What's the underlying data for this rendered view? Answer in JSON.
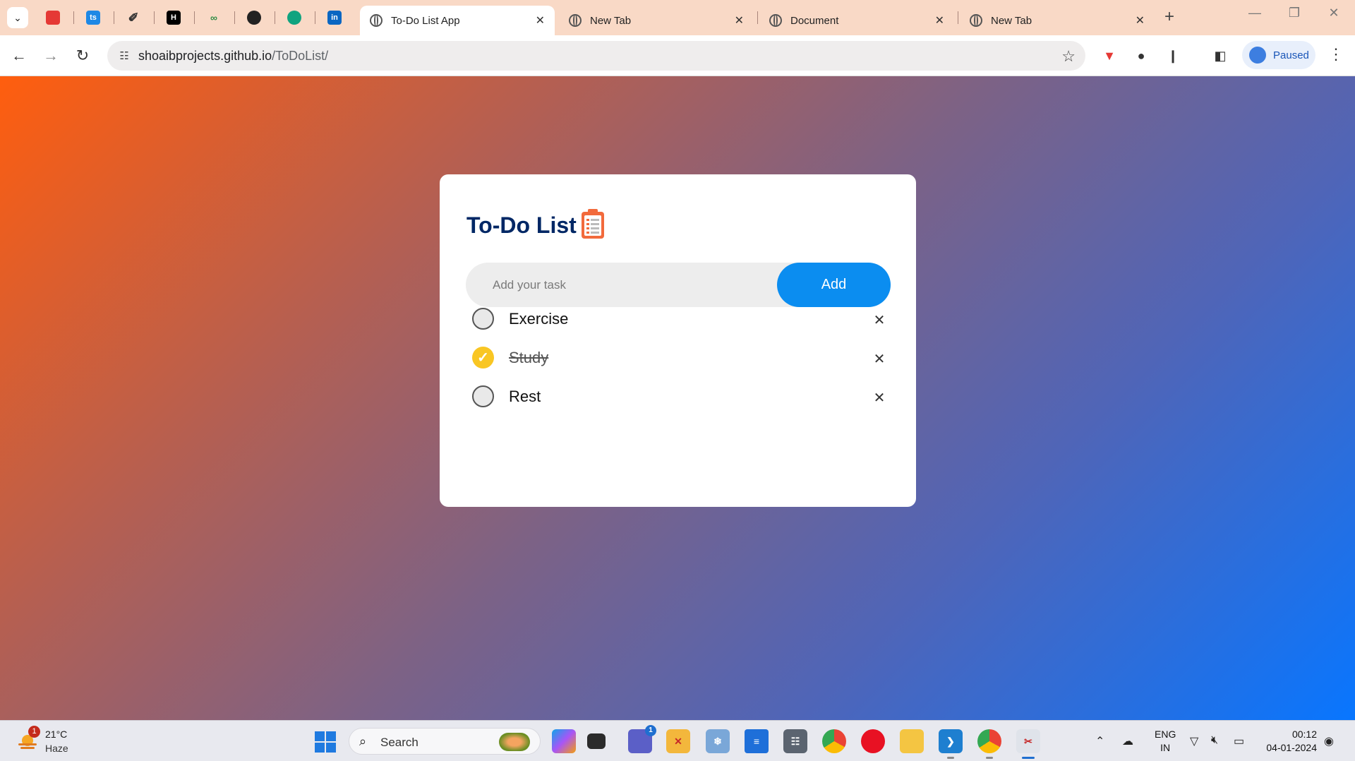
{
  "browser": {
    "pinned_tabs": [
      {
        "icon": "red-bookmark-icon",
        "color": "#e53935"
      },
      {
        "icon": "ts-icon",
        "color": "#1e88e5",
        "text": "ts"
      },
      {
        "icon": "pen-tool-icon",
        "color": "#333333"
      },
      {
        "icon": "hackernoon-icon",
        "color": "#000000",
        "text": "H"
      },
      {
        "icon": "geeksforgeeks-icon",
        "color": "#2f8d46"
      },
      {
        "icon": "github-icon",
        "color": "#222222"
      },
      {
        "icon": "chatgpt-icon",
        "color": "#10a37f"
      },
      {
        "icon": "linkedin-icon",
        "color": "#0a66c2",
        "text": "in"
      }
    ],
    "tabs": [
      {
        "title": "To-Do List App",
        "active": true
      },
      {
        "title": "New Tab",
        "active": false
      },
      {
        "title": "Document",
        "active": false
      },
      {
        "title": "New Tab",
        "active": false
      }
    ],
    "url_domain": "shoaibprojects.github.io",
    "url_path": "/ToDoList/",
    "profile_status": "Paused"
  },
  "app": {
    "title": "To-Do List",
    "input_placeholder": "Add your task",
    "input_value": "",
    "add_label": "Add",
    "tasks": [
      {
        "label": "Exercise",
        "done": false
      },
      {
        "label": "Study",
        "done": true
      },
      {
        "label": "Rest",
        "done": false
      }
    ],
    "colors": {
      "title": "#002765",
      "add_button": "#0b8df0",
      "checked": "#f9c623",
      "gradient_start": "#ff5e0e",
      "gradient_end": "#0876ff"
    }
  },
  "taskbar": {
    "weather_badge": "1",
    "temperature": "21°C",
    "condition": "Haze",
    "search_label": "Search",
    "teams_badge": "1",
    "lang_line1": "ENG",
    "lang_line2": "IN",
    "time": "00:12",
    "date": "04-01-2024"
  }
}
